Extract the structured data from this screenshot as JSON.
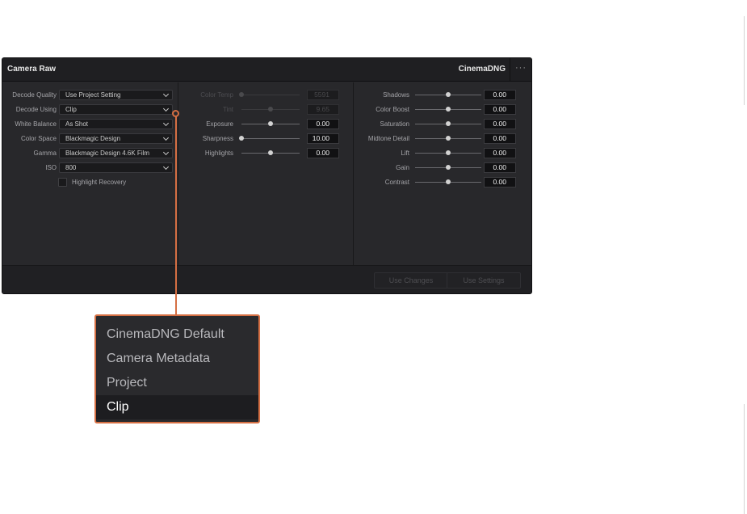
{
  "panel": {
    "title": "Camera Raw",
    "format": "CinemaDNG",
    "menu": "···"
  },
  "decode": {
    "fields": [
      {
        "label": "Decode Quality",
        "value": "Use Project Setting"
      },
      {
        "label": "Decode Using",
        "value": "Clip"
      },
      {
        "label": "White Balance",
        "value": "As Shot"
      },
      {
        "label": "Color Space",
        "value": "Blackmagic Design"
      },
      {
        "label": "Gamma",
        "value": "Blackmagic Design 4.6K Film"
      },
      {
        "label": "ISO",
        "value": "800"
      }
    ],
    "highlight_recovery": {
      "label": "Highlight Recovery",
      "checked": false
    }
  },
  "middle_sliders": [
    {
      "label": "Color Temp",
      "value": "5591",
      "position": 0.0,
      "enabled": false
    },
    {
      "label": "Tint",
      "value": "9.65",
      "position": 0.5,
      "enabled": false
    },
    {
      "label": "Exposure",
      "value": "0.00",
      "position": 0.5,
      "enabled": true
    },
    {
      "label": "Sharpness",
      "value": "10.00",
      "position": 0.0,
      "enabled": true
    },
    {
      "label": "Highlights",
      "value": "0.00",
      "position": 0.5,
      "enabled": true
    }
  ],
  "right_sliders": [
    {
      "label": "Shadows",
      "value": "0.00",
      "position": 0.5
    },
    {
      "label": "Color Boost",
      "value": "0.00",
      "position": 0.5
    },
    {
      "label": "Saturation",
      "value": "0.00",
      "position": 0.5
    },
    {
      "label": "Midtone Detail",
      "value": "0.00",
      "position": 0.5
    },
    {
      "label": "Lift",
      "value": "0.00",
      "position": 0.5
    },
    {
      "label": "Gain",
      "value": "0.00",
      "position": 0.5
    },
    {
      "label": "Contrast",
      "value": "0.00",
      "position": 0.5
    }
  ],
  "footer": {
    "use_changes": "Use Changes",
    "use_settings": "Use Settings"
  },
  "decode_using_menu": {
    "options": [
      "CinemaDNG Default",
      "Camera Metadata",
      "Project",
      "Clip"
    ],
    "selected": "Clip"
  },
  "colors": {
    "callout_accent": "#d56f43",
    "panel_background": "#28282b"
  }
}
